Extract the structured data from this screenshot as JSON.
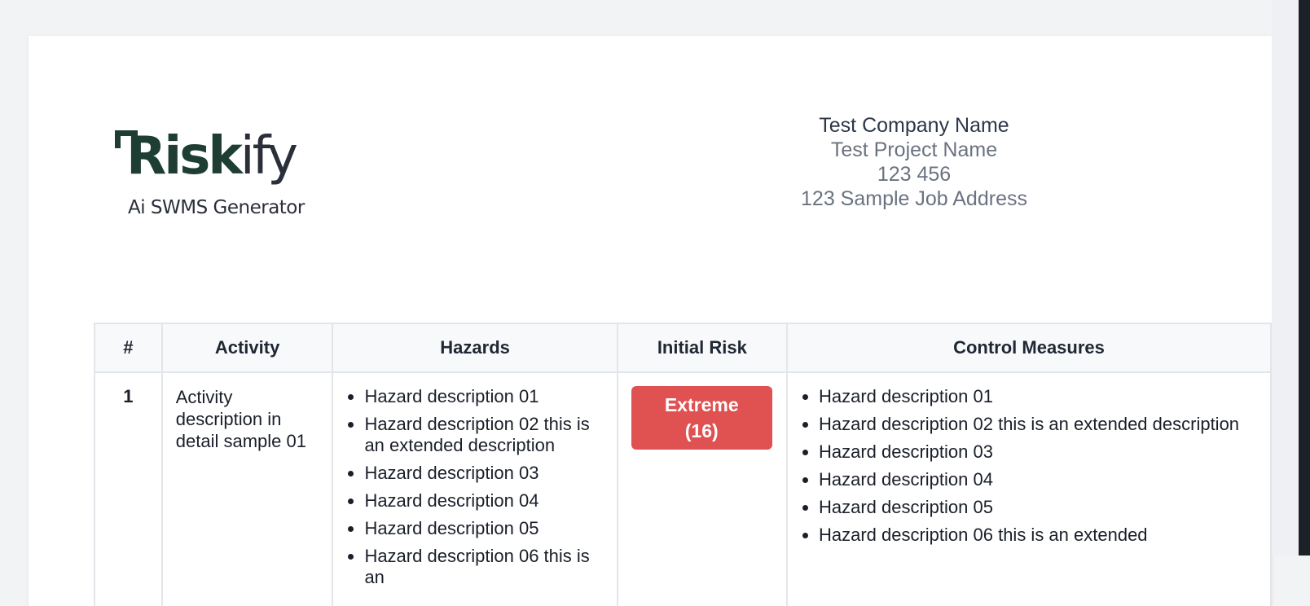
{
  "logo": {
    "word_main": "Risk",
    "word_tail": "ify",
    "tagline": "Ai SWMS Generator",
    "colors": {
      "primary": "#1e3d33",
      "secondary": "#2b2f3a"
    }
  },
  "company": {
    "name": "Test Company Name",
    "project": "Test Project Name",
    "number": "123 456",
    "address": "123 Sample Job Address"
  },
  "table": {
    "headers": {
      "number": "#",
      "activity": "Activity",
      "hazards": "Hazards",
      "initial_risk": "Initial Risk",
      "control_measures": "Control Measures"
    },
    "rows": [
      {
        "number": "1",
        "activity": "Activity description in detail sample 01",
        "hazards": [
          "Hazard description 01",
          "Hazard description 02 this is an extended description",
          "Hazard description 03",
          "Hazard description 04",
          "Hazard description 05",
          "Hazard description 06 this is an"
        ],
        "initial_risk": {
          "level": "Extreme",
          "score": "(16)",
          "color": "#e05252"
        },
        "control_measures": [
          "Hazard description 01",
          "Hazard description 02 this is an extended description",
          "Hazard description 03",
          "Hazard description 04",
          "Hazard description 05",
          "Hazard description 06 this is an extended"
        ]
      }
    ]
  }
}
